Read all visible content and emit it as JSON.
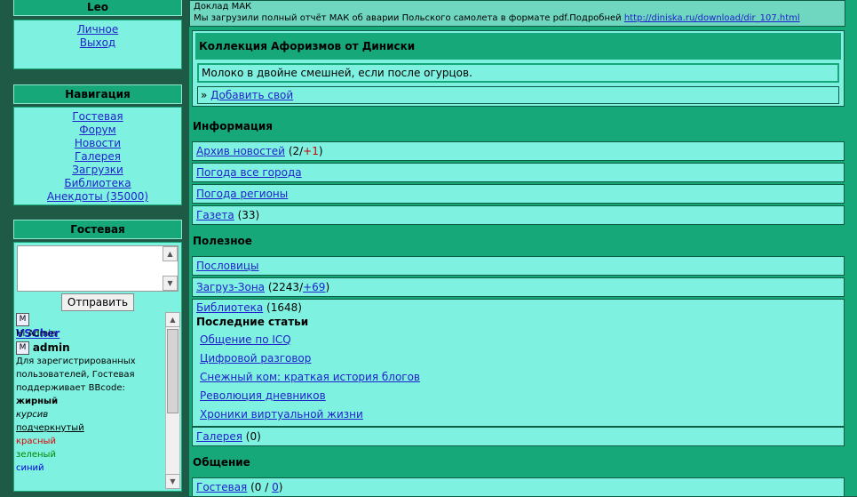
{
  "user": {
    "name": "Leo",
    "links": [
      "Личное",
      "Выход"
    ]
  },
  "nav": {
    "title": "Навигация",
    "items": [
      "Гостевая",
      "Форум",
      "Новости",
      "Галерея",
      "Загрузки",
      "Библиотека",
      "Анекдоты (35000)"
    ]
  },
  "guestbook": {
    "title": "Гостевая",
    "textarea_value": "",
    "send_button": "Отправить",
    "messages": [
      {
        "badge": "M",
        "author": "VSCher",
        "text": "Hi Admin"
      },
      {
        "badge": "M",
        "author": "admin",
        "text": "Для зарегистрированных пользователей, Гостевая поддерживает BBcode:"
      }
    ],
    "format_examples": [
      "жирный",
      "курсив",
      "подчеркнутый",
      "красный",
      "зеленый",
      "синий"
    ],
    "colors": {
      "red": "#e00000",
      "green": "#008800",
      "blue": "#0000dd"
    }
  },
  "top_notice": {
    "title": "Доклад МАК",
    "text": "Мы загрузили полный отчёт МАК об аварии Польского самолета в формате pdf.Подробней",
    "link": "http://diniska.ru/download/dir_107.html"
  },
  "aphorism": {
    "title": "Коллекция Афоризмов от Диниски",
    "quote": "Молоко в двойне смешней, если после огурцов.",
    "add_prefix": "»",
    "add_link": "Добавить свой"
  },
  "info": {
    "title": "Информация",
    "archive_label": "Архив новостей",
    "archive_count": "(2/",
    "archive_new": "+1",
    "archive_close": ")",
    "weather_all": "Погода все города",
    "weather_regions": "Погода регионы",
    "gazeta_label": "Газета",
    "gazeta_count": "(33)"
  },
  "useful": {
    "title": "Полезное",
    "proverbs": "Пословицы",
    "zagruz_label": "Загруз-Зона",
    "zagruz_count": "(2243/",
    "zagruz_new": "+69",
    "zagruz_close": ")",
    "library_label": "Библиотека",
    "library_count": "(1648)",
    "latest_title": "Последние статьи",
    "articles": [
      "Общение по ICQ",
      "Цифровой разговор",
      "Снежный ком: краткая история блогов",
      "Революция дневников",
      "Хроники виртуальной жизни"
    ],
    "gallery_label": "Галерея",
    "gallery_count": "(0)"
  },
  "communication": {
    "title": "Общение",
    "guest_label": "Гостевая",
    "guest_open": "(0 /",
    "guest_new": "0",
    "guest_close": ")"
  }
}
